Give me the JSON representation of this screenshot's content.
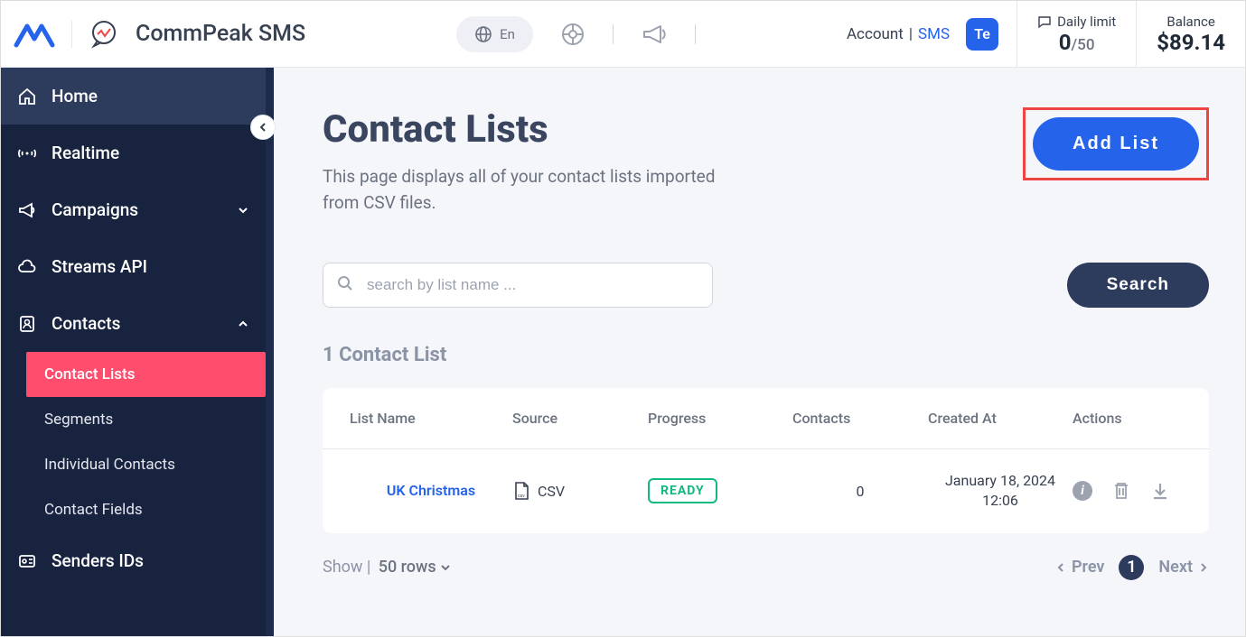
{
  "header": {
    "app_title": "CommPeak SMS",
    "lang": "En",
    "account_label": "Account",
    "account_link": "SMS",
    "avatar": "Te",
    "daily_label": "Daily limit",
    "daily_used": "0",
    "daily_total": "/50",
    "balance_label": "Balance",
    "balance_value": "$89.14"
  },
  "sidebar": {
    "home": "Home",
    "realtime": "Realtime",
    "campaigns": "Campaigns",
    "streams": "Streams API",
    "contacts": "Contacts",
    "contact_lists": "Contact Lists",
    "segments": "Segments",
    "individual": "Individual Contacts",
    "fields": "Contact Fields",
    "senders": "Senders IDs"
  },
  "main": {
    "title": "Contact Lists",
    "desc": "This page displays all of your contact lists imported from CSV files.",
    "add_btn": "Add List",
    "search_placeholder": "search by list name ...",
    "search_btn": "Search",
    "count_label": "1 Contact List",
    "columns": {
      "name": "List Name",
      "source": "Source",
      "progress": "Progress",
      "contacts": "Contacts",
      "created": "Created At",
      "actions": "Actions"
    },
    "row": {
      "name": "UK Christmas",
      "source": "CSV",
      "progress": "READY",
      "contacts": "0",
      "created": "January 18, 2024 12:06"
    },
    "pager": {
      "show": "Show",
      "rows": "50 rows",
      "prev": "Prev",
      "page": "1",
      "next": "Next"
    }
  }
}
